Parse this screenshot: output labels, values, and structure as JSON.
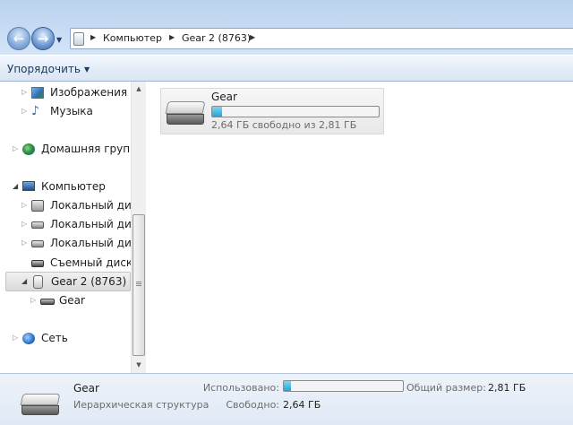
{
  "address": {
    "crumbs": [
      "Компьютер",
      "Gear 2 (8763)"
    ]
  },
  "toolbar": {
    "organize_label": "Упорядочить"
  },
  "nav": {
    "items": [
      {
        "label": "Изображения",
        "icon": "pictures-icon"
      },
      {
        "label": "Музыка",
        "icon": "music-icon"
      },
      {
        "label": "Домашняя группа",
        "icon": "homegroup-icon"
      },
      {
        "label": "Компьютер",
        "icon": "computer-icon"
      },
      {
        "label": "Локальный диск",
        "icon": "windows-drive-icon"
      },
      {
        "label": "Локальный диск",
        "icon": "hard-drive-icon"
      },
      {
        "label": "Локальный диск",
        "icon": "hard-drive-icon"
      },
      {
        "label": "Съемный диск (",
        "icon": "removable-drive-icon"
      },
      {
        "label": "Gear 2 (8763)",
        "icon": "portable-device-icon",
        "selected": true
      },
      {
        "label": "Gear",
        "icon": "drive-icon"
      },
      {
        "label": "Сеть",
        "icon": "network-icon"
      }
    ]
  },
  "drive_tile": {
    "name": "Gear",
    "free_text": "2,64 ГБ свободно из 2,81 ГБ",
    "used_fraction": 0.06,
    "fill_color": "#26a0da"
  },
  "details": {
    "name": "Gear",
    "type": "Иерархическая структура",
    "used_label": "Использовано:",
    "used_fraction": 0.06,
    "total_label": "Общий размер:",
    "total_value": "2,81 ГБ",
    "free_label": "Свободно:",
    "free_value": "2,64 ГБ"
  }
}
